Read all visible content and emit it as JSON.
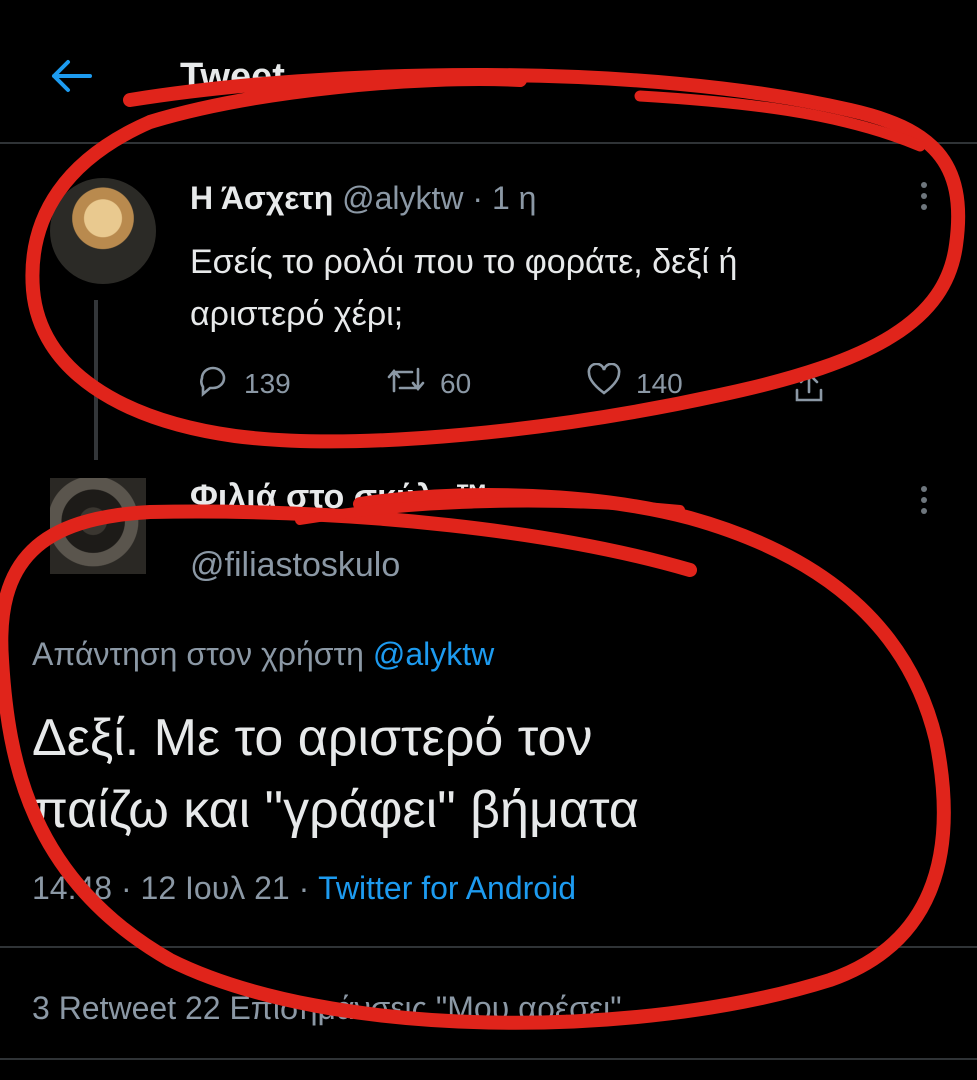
{
  "header": {
    "title": "Tweet"
  },
  "parent_tweet": {
    "display_name": "Η Άσχετη",
    "handle": "@alyktw",
    "time": "· 1 η",
    "text_line1": "Εσείς το ρολόι που το φοράτε, δεξί ή",
    "text_line2": "αριστερό χέρι;",
    "replies": "139",
    "retweets": "60",
    "likes": "140"
  },
  "main_tweet": {
    "display_name": "Φιλιά στο σκύλο™",
    "handle": "@filiastoskulo",
    "reply_prefix": "Απάντηση στον χρήστη",
    "reply_to": "@alyktw",
    "text_line1": "Δεξί. Με το αριστερό τον",
    "text_line2": "παίζω και \"γράφει\" βήματα",
    "timestamp": "14:48 · 12 Ιουλ 21 ·",
    "source": "Twitter for Android",
    "stats_text": "3 Retweet 22 Επισημάνσεις \"Μου αρέσει\""
  },
  "colors": {
    "accent": "#1d9bf0",
    "annotation": "#e0241b",
    "background": "#000000"
  },
  "icons": [
    "back-arrow-icon",
    "reply-icon",
    "retweet-icon",
    "like-icon",
    "share-icon",
    "more-icon"
  ]
}
